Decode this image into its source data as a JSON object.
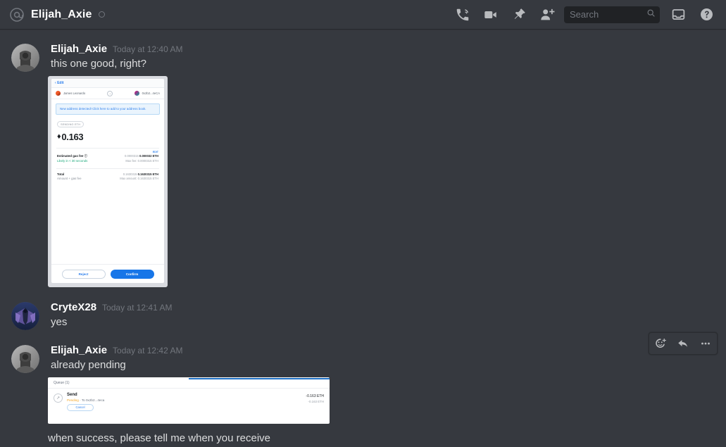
{
  "header": {
    "at_icon": "at-icon",
    "title": "Elijah_Axie",
    "status": "offline",
    "icons": [
      {
        "name": "start-call-icon",
        "label": "Start Voice Call"
      },
      {
        "name": "video-call-icon",
        "label": "Start Video Call"
      },
      {
        "name": "pinned-messages-icon",
        "label": "Pinned Messages"
      },
      {
        "name": "add-friends-icon",
        "label": "Add Friends to DM"
      },
      {
        "name": "inbox-icon",
        "label": "Inbox"
      },
      {
        "name": "help-icon",
        "label": "Help"
      }
    ],
    "search": {
      "placeholder": "Search",
      "value": "",
      "icon": "search-icon"
    }
  },
  "hover_toolbar": {
    "add_reaction": "Add Reaction",
    "reply": "Reply",
    "more": "More"
  },
  "messages": [
    {
      "author": "Elijah_Axie",
      "timestamp": "Today at 12:40 AM",
      "text": "this one good, right?",
      "avatar": "elijah-avatar"
    },
    {
      "author": "CryteX28",
      "timestamp": "Today at 12:41 AM",
      "text": "yes",
      "avatar": "crytex-avatar"
    },
    {
      "author": "Elijah_Axie",
      "timestamp": "Today at 12:42 AM",
      "text": "already pending",
      "avatar": "elijah-avatar"
    }
  ],
  "trailing_text": "when success, please tell me when you receive",
  "embed_confirm": {
    "back_label": "Edit",
    "from_name": "James Leonardo",
    "to_name": "0x2b2...4eCA",
    "arrow": "→",
    "banner": "New address detected! Click here to add to your address book.",
    "sending_label": "SENDING ETH",
    "eth_glyph": "♦",
    "amount": "0.163",
    "edit_link": "EDIT",
    "gas_label": "Estimated gas fee",
    "gas_info_icon": "info-icon",
    "gas_sub": "Likely in < 30 seconds",
    "gas_value_dim": "0.0000315",
    "gas_value": "0.000032 ETH",
    "gas_max_label": "Max fee:",
    "gas_max": "0.0000315 ETH",
    "total_label": "Total",
    "total_sub": "Amount + gas fee",
    "total_value_dim": "0.1630315",
    "total_value": "0.1630315 ETH",
    "total_max_label": "Max amount:",
    "total_max": "0.1630315 ETH",
    "reject_label": "Reject",
    "confirm_label": "Confirm"
  },
  "embed_queue": {
    "queue_label": "Queue (1)",
    "send_title": "Send",
    "status_pending": "Pending",
    "status_rest": " · To 0x2b2...4eca",
    "cancel_label": "Cancel",
    "value_primary": "-0.163 ETH",
    "value_secondary": "-0.163 ETH",
    "send_icon": "send-arrow-icon"
  },
  "colors": {
    "app_bg": "#36393f",
    "header_bg": "#36393f",
    "search_bg": "#202225",
    "text_primary": "#dcddde",
    "text_muted": "#72767d",
    "blue_accent": "#1776e8",
    "pending_orange": "#f5a623"
  }
}
